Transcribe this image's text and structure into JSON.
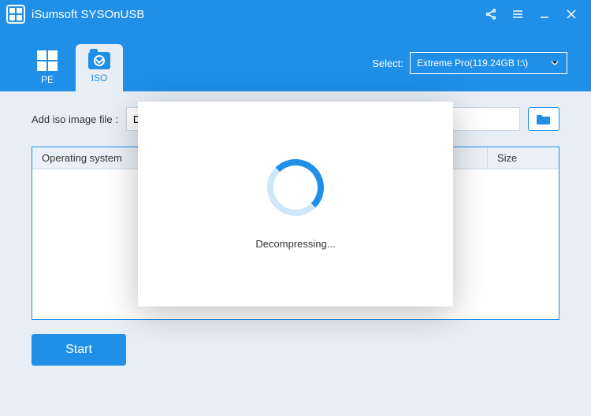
{
  "titlebar": {
    "title": "iSumsoft SYSOnUSB"
  },
  "tabs": {
    "pe_label": "PE",
    "iso_label": "ISO"
  },
  "select": {
    "label": "Select:",
    "value": "Extreme Pro(119.24GB I:\\)"
  },
  "file_row": {
    "label": "Add iso image file :",
    "value": "D:/W"
  },
  "table": {
    "headers": {
      "os": "Operating system",
      "size": "Size"
    }
  },
  "buttons": {
    "start": "Start"
  },
  "modal": {
    "status_text": "Decompressing..."
  }
}
